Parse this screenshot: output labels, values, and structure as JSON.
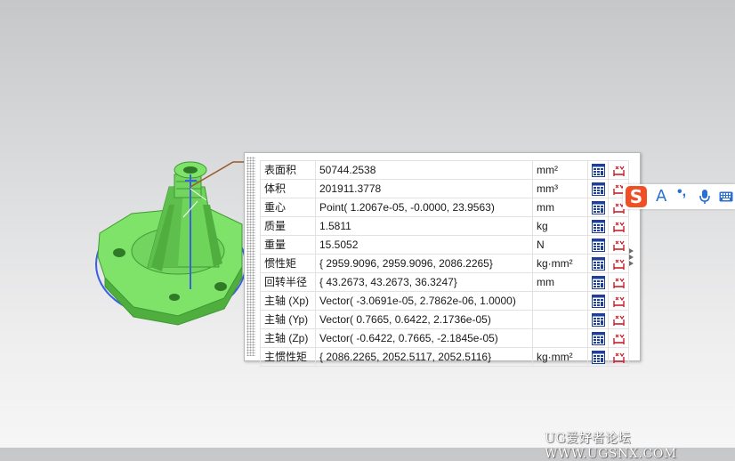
{
  "properties": [
    {
      "name": "表面积",
      "value": "50744.2538",
      "unit": "mm²"
    },
    {
      "name": "体积",
      "value": "201911.3778",
      "unit": "mm³"
    },
    {
      "name": "重心",
      "value": "Point( 1.2067e-05, -0.0000, 23.9563)",
      "unit": "mm"
    },
    {
      "name": "质量",
      "value": "1.5811",
      "unit": "kg"
    },
    {
      "name": "重量",
      "value": "15.5052",
      "unit": "N"
    },
    {
      "name": "惯性矩",
      "value": "{ 2959.9096, 2959.9096, 2086.2265}",
      "unit": "kg·mm²"
    },
    {
      "name": "回转半径",
      "value": "{ 43.2673, 43.2673, 36.3247}",
      "unit": "mm"
    },
    {
      "name": "主轴 (Xp)",
      "value": "Vector( -3.0691e-05, 2.7862e-06, 1.0000)",
      "unit": ""
    },
    {
      "name": "主轴 (Yp)",
      "value": "Vector( 0.7665, 0.6422, 2.1736e-05)",
      "unit": ""
    },
    {
      "name": "主轴 (Zp)",
      "value": "Vector( -0.6422, 0.7665, -2.1845e-05)",
      "unit": ""
    },
    {
      "name": "主惯性矩",
      "value": "{ 2086.2265, 2052.5117, 2052.5116}",
      "unit": "kg·mm²"
    }
  ],
  "ime": {
    "logo": "S",
    "lang": "A",
    "punct": "•,"
  },
  "watermark": "UG爱好者论坛 WWW.UGSNX.COM",
  "colors": {
    "model": "#7fe36a",
    "model_shadow": "#3f9a33",
    "axis": "#3a5fe0",
    "leader": "#9a5a2a"
  }
}
